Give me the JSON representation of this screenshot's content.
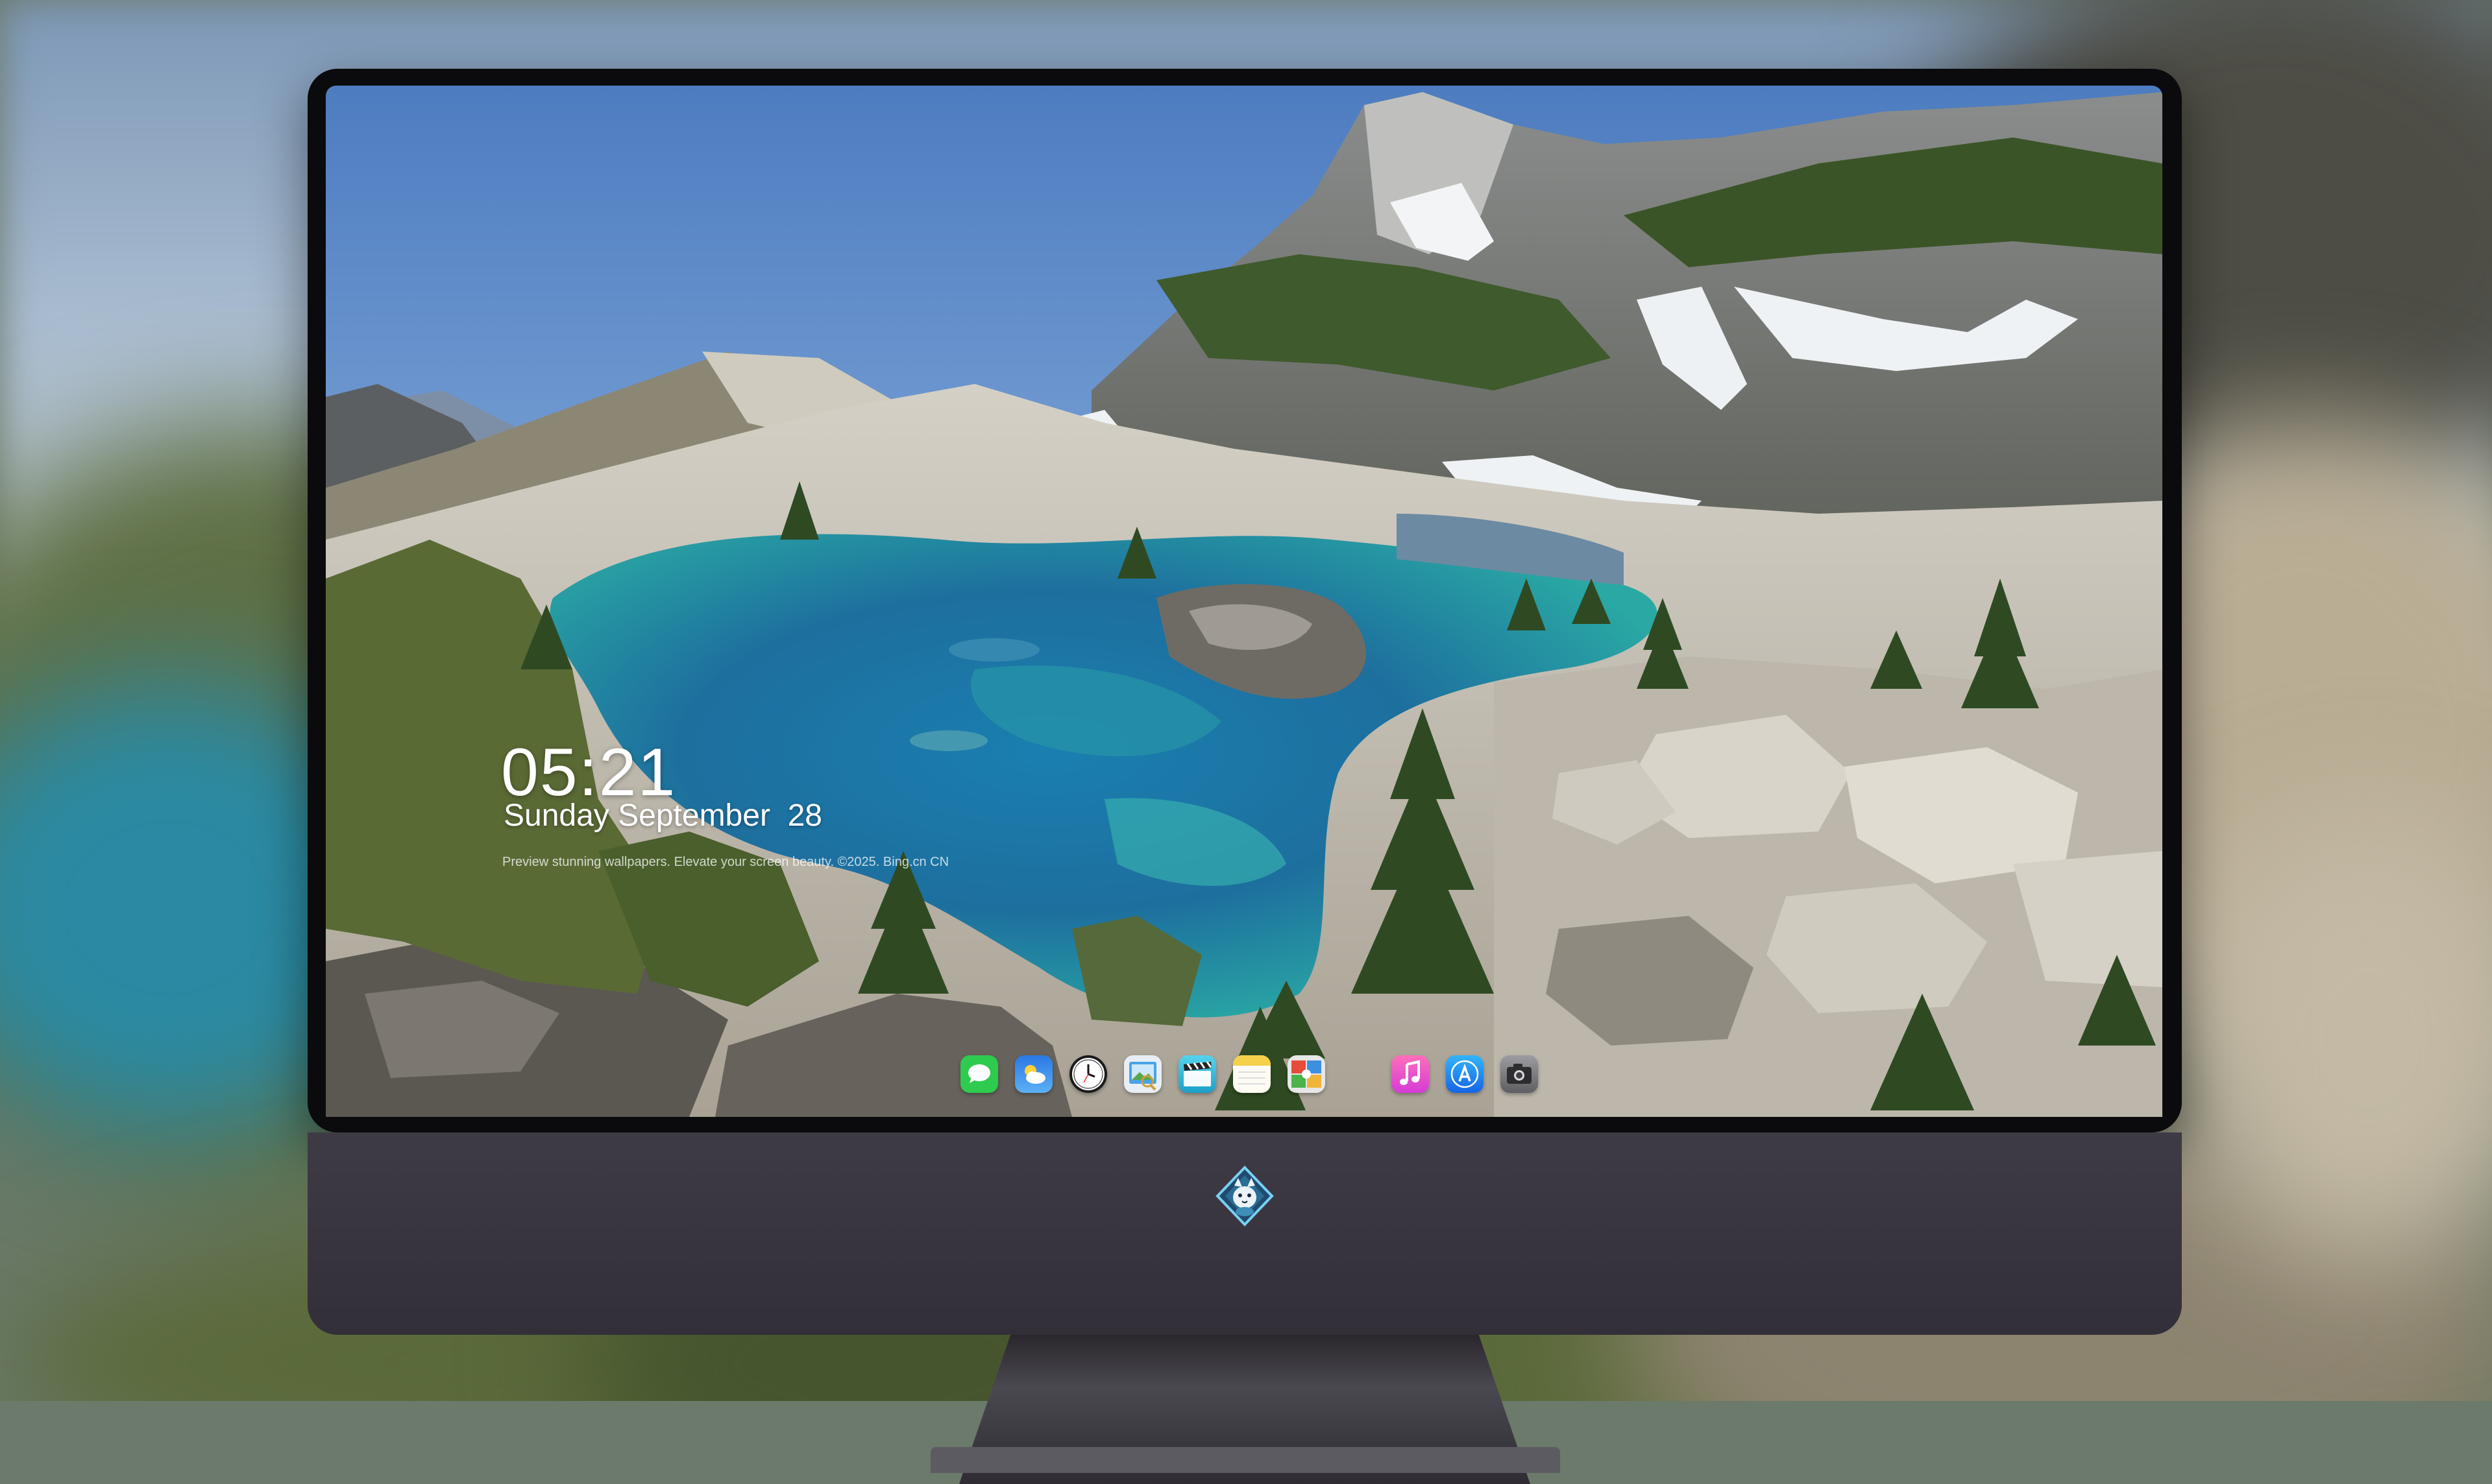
{
  "lockscreen": {
    "time": "05:21",
    "date": "Sunday September  28",
    "caption": "Preview stunning wallpapers. Elevate your screen beauty. ©2025. Bing.cn CN"
  },
  "dock": {
    "apps": [
      {
        "name": "messages",
        "icon": "messages-icon",
        "color": "#2fcb4f"
      },
      {
        "name": "weather",
        "icon": "weather-icon",
        "color": "#3a8ef0"
      },
      {
        "name": "clock",
        "icon": "clock-icon",
        "color": "#111111"
      },
      {
        "name": "preview",
        "icon": "preview-icon",
        "color": "#4aa3e8"
      },
      {
        "name": "clips",
        "icon": "clapperboard-icon",
        "color": "#2bb7d9"
      },
      {
        "name": "notes",
        "icon": "notes-icon",
        "color": "#f5d04a"
      },
      {
        "name": "photo-gallery",
        "icon": "gallery-icon",
        "color": "#e7e7e7"
      },
      {
        "name": "music",
        "icon": "music-icon",
        "color": "#f35aa8"
      },
      {
        "name": "app-store",
        "icon": "app-store-icon",
        "color": "#1f8ff2"
      },
      {
        "name": "camera",
        "icon": "camera-icon",
        "color": "#6f6f74"
      }
    ]
  },
  "brand_logo": "wolf-mascot-logo"
}
